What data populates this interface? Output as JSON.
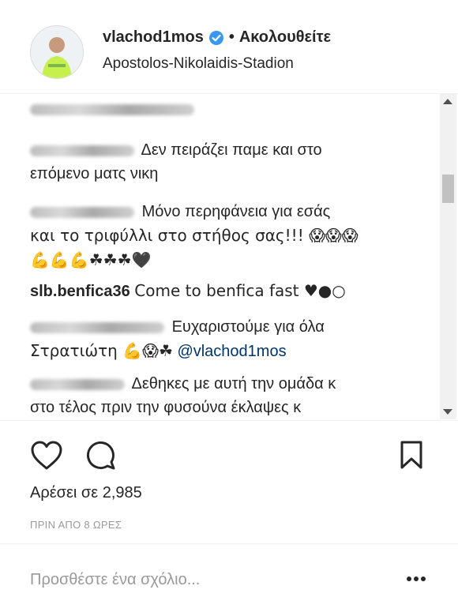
{
  "header": {
    "username": "vlachod1mos",
    "separator": "•",
    "follow_label": "Ακολουθείτε",
    "location": "Apostolos-Nikolaidis-Stadion"
  },
  "comments": [
    {
      "author": "",
      "text": ""
    },
    {
      "author": "",
      "line1": "Δεν πειράζει παμε και στο",
      "line2": "επόμενο ματς νικη"
    },
    {
      "author": "",
      "line1": "Μόνο περηφάνεια για εσάς",
      "line2": "και το τριφύλλι στο στήθος σας!!! 😱😱😱",
      "line3": "💪💪💪☘☘☘🖤"
    },
    {
      "author": "slb.benfica36",
      "text": "Come to benfica fast ♥●○"
    },
    {
      "author": "",
      "line1": "Ευχαριστούμε για όλα",
      "line2_prefix": "Στρατιώτη 💪😱☘",
      "mention": "@vlachod1mos"
    },
    {
      "author": "",
      "line1": "Δεθηκες με αυτή την ομάδα κ",
      "line2": "στο τέλος πριν την φυσούνα έκλαψες κ"
    }
  ],
  "actions": {
    "likes": "Αρέσει σε 2,985",
    "time": "ΠΡΙΝ ΑΠΟ 8 ΩΡΕΣ"
  },
  "add_comment": {
    "placeholder": "Προσθέστε ένα σχόλιο..."
  },
  "icons": [
    "verified-icon",
    "heart-icon",
    "comment-icon",
    "bookmark-icon",
    "more-icon"
  ],
  "colors": {
    "verified": "#3897f0",
    "mention": "#003569",
    "muted": "#999999"
  }
}
